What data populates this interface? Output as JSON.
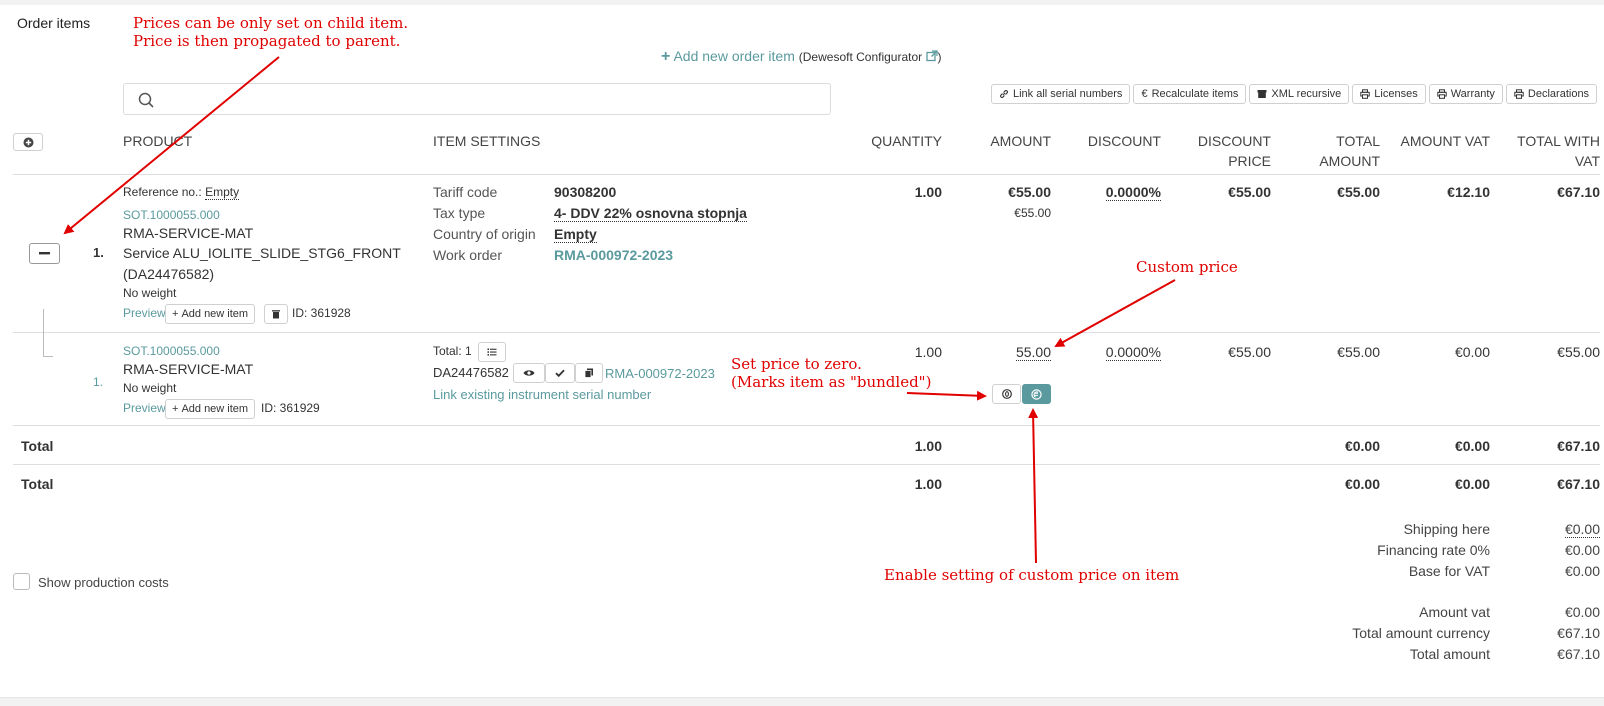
{
  "section": {
    "title": "Order items"
  },
  "annotations": {
    "child_price_line1": "Prices can be only set on child item.",
    "child_price_line2": "Price is then propagated to parent.",
    "custom_price": "Custom price",
    "zero_line1": "Set price to zero.",
    "zero_line2": "(Marks item as \"bundled\")",
    "enable_custom": "Enable setting of custom price on item"
  },
  "add_item": {
    "plus": "+",
    "label": "Add new order item",
    "configurator": "(Dewesoft Configurator",
    "close_paren": ")"
  },
  "search": {
    "placeholder": ""
  },
  "toolbar": [
    {
      "label": "Link all serial numbers",
      "icon": "link-icon"
    },
    {
      "label": "Recalculate items",
      "icon": "euro-icon"
    },
    {
      "label": "XML recursive",
      "icon": "archive-icon"
    },
    {
      "label": "Licenses",
      "icon": "print-icon"
    },
    {
      "label": "Warranty",
      "icon": "print-icon"
    },
    {
      "label": "Declarations",
      "icon": "print-icon"
    }
  ],
  "columns": {
    "product": "PRODUCT",
    "item_settings": "ITEM SETTINGS",
    "quantity": "QUANTITY",
    "amount": "AMOUNT",
    "discount": "DISCOUNT",
    "discount_price_1": "DISCOUNT",
    "discount_price_2": "PRICE",
    "total_amount_1": "TOTAL",
    "total_amount_2": "AMOUNT",
    "amount_vat": "AMOUNT VAT",
    "total_with_vat_1": "TOTAL WITH",
    "total_with_vat_2": "VAT"
  },
  "parent_item": {
    "index": "1.",
    "reference_label": "Reference no.:",
    "reference_value": "Empty",
    "sot": "SOT.1000055.000",
    "code": "RMA-SERVICE-MAT",
    "name": "Service ALU_IOLITE_SLIDE_STG6_FRONT",
    "serial": "(DA24476582)",
    "weight": "No weight",
    "preview": "Preview",
    "add_new_item": "Add new item",
    "id": "ID: 361928",
    "settings": [
      {
        "label": "Tariff code",
        "value": "90308200"
      },
      {
        "label": "Tax type",
        "value": "4- DDV 22% osnovna stopnja"
      },
      {
        "label": "Country of origin",
        "value": "Empty"
      },
      {
        "label": "Work order",
        "value": "RMA-000972-2023"
      }
    ],
    "quantity": "1.00",
    "amount": "€55.00",
    "amount_sub": "€55.00",
    "discount": "0.0000%",
    "discount_price": "€55.00",
    "total_amount": "€55.00",
    "amount_vat": "€12.10",
    "total_with_vat": "€67.10"
  },
  "child_item": {
    "index": "1.",
    "sot": "SOT.1000055.000",
    "code": "RMA-SERVICE-MAT",
    "weight": "No weight",
    "preview": "Preview",
    "add_new_item": "Add new item",
    "id": "ID: 361929",
    "total_label": "Total: 1",
    "serial": "DA24476582",
    "work_order": "RMA-000972-2023",
    "link_serial": "Link existing instrument serial number",
    "quantity": "1.00",
    "amount": "55.00",
    "discount": "0.0000%",
    "discount_price": "€55.00",
    "total_amount": "€55.00",
    "amount_vat": "€0.00",
    "total_with_vat": "€55.00"
  },
  "totals": [
    {
      "label": "Total",
      "quantity": "1.00",
      "total_amount": "€0.00",
      "amount_vat": "€0.00",
      "total_with_vat": "€67.10"
    },
    {
      "label": "Total",
      "quantity": "1.00",
      "total_amount": "€0.00",
      "amount_vat": "€0.00",
      "total_with_vat": "€67.10"
    }
  ],
  "show_production_costs": "Show production costs",
  "summary": [
    {
      "label": "Shipping here",
      "value": "€0.00"
    },
    {
      "label": "Financing rate 0%",
      "value": "€0.00"
    },
    {
      "label": "Base for VAT",
      "value": "€0.00"
    },
    {
      "label": "Amount vat",
      "value": "€0.00"
    },
    {
      "label": "Total amount currency",
      "value": "€67.10"
    },
    {
      "label": "Total amount",
      "value": "€67.10"
    }
  ],
  "colors": {
    "teal": "#5a9a9e",
    "annotation": "#e00000"
  }
}
